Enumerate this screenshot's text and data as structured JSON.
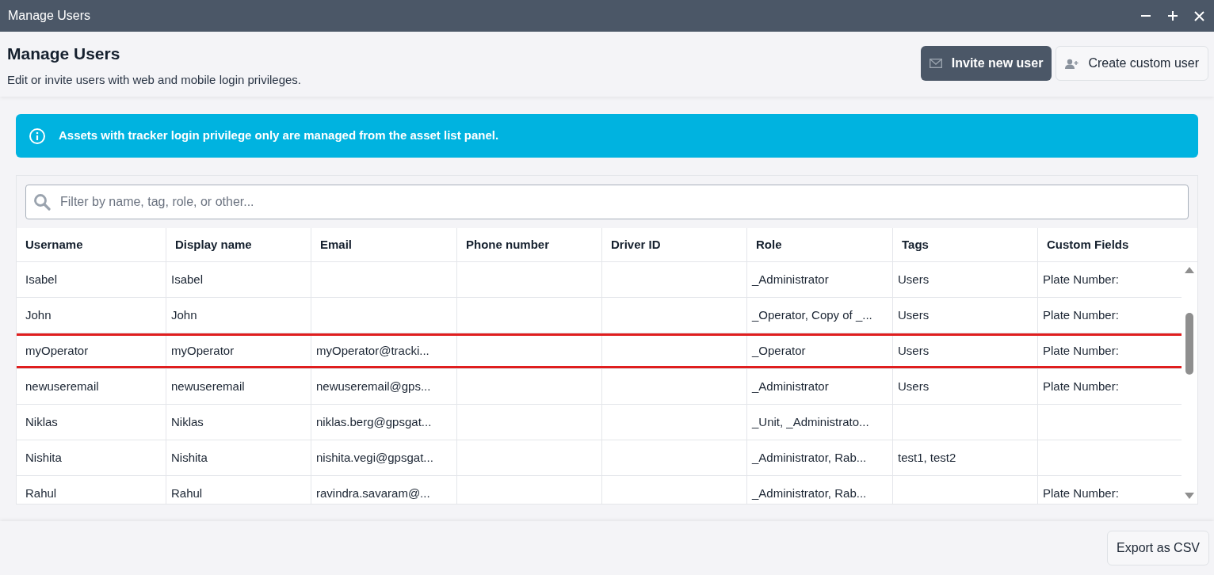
{
  "window": {
    "title": "Manage Users"
  },
  "header": {
    "title": "Manage Users",
    "subtitle": "Edit or invite users with web and mobile login privileges."
  },
  "actions": [
    {
      "label": "Invite new user",
      "kind": "primary"
    },
    {
      "label": "Create custom user",
      "kind": "secondary"
    }
  ],
  "banner": {
    "text": "Assets with tracker login privilege only are managed from the asset list panel."
  },
  "search": {
    "placeholder": "Filter by name, tag, role, or other..."
  },
  "table": {
    "columns": [
      "Username",
      "Display name",
      "Email",
      "Phone number",
      "Driver ID",
      "Role",
      "Tags",
      "Custom Fields"
    ],
    "rows": [
      {
        "cells": [
          "Isabel",
          "Isabel",
          "",
          "",
          "",
          "_Administrator",
          "Users",
          "Plate Number:"
        ],
        "highlighted": false
      },
      {
        "cells": [
          "John",
          "John",
          "",
          "",
          "",
          "_Operator, Copy of _...",
          "Users",
          "Plate Number:"
        ],
        "highlighted": false
      },
      {
        "cells": [
          "myOperator",
          "myOperator",
          "myOperator@tracki...",
          "",
          "",
          "_Operator",
          "Users",
          "Plate Number:"
        ],
        "highlighted": true
      },
      {
        "cells": [
          "newuseremail",
          "newuseremail",
          "newuseremail@gps...",
          "",
          "",
          "_Administrator",
          "Users",
          "Plate Number:"
        ],
        "highlighted": false
      },
      {
        "cells": [
          "Niklas",
          "Niklas",
          "niklas.berg@gpsgat...",
          "",
          "",
          "_Unit, _Administrato...",
          "",
          ""
        ],
        "highlighted": false
      },
      {
        "cells": [
          "Nishita",
          "Nishita",
          "nishita.vegi@gpsgat...",
          "",
          "",
          "_Administrator, Rab...",
          "test1, test2",
          ""
        ],
        "highlighted": false
      },
      {
        "cells": [
          "Rahul",
          "Rahul",
          "ravindra.savaram@...",
          "",
          "",
          "_Administrator, Rab...",
          "",
          "Plate Number:"
        ],
        "highlighted": false
      }
    ]
  },
  "footer": {
    "button": "Export as CSV"
  }
}
